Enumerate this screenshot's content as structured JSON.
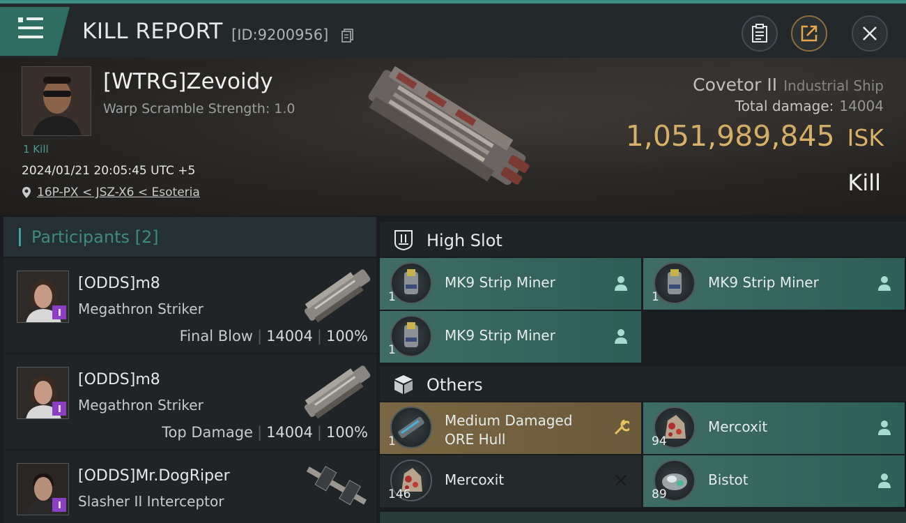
{
  "header": {
    "title": "KILL REPORT",
    "report_id": "[ID:9200956]"
  },
  "victim": {
    "name": "[WTRG]Zevoidy",
    "warp_scramble": "Warp Scramble Strength: 1.0",
    "kill_count": "1 Kill",
    "timestamp": "2024/01/21 20:05:45 UTC +5",
    "location": "16P-PX < JSZ-X6 < Esoteria",
    "ship_name": "Covetor II",
    "ship_class": "Industrial Ship",
    "total_damage_label": "Total damage:",
    "total_damage_value": "14004",
    "isk_value": "1,051,989,845",
    "isk_unit": "ISK",
    "result": "Kill"
  },
  "participants": {
    "header": "Participants [2]",
    "items": [
      {
        "name": "[ODDS]m8",
        "ship": "Megathron Striker",
        "role": "Final Blow",
        "damage": "14004",
        "percent": "100%"
      },
      {
        "name": "[ODDS]m8",
        "ship": "Megathron Striker",
        "role": "Top Damage",
        "damage": "14004",
        "percent": "100%"
      },
      {
        "name": "[ODDS]Mr.DogRiper",
        "ship": "Slasher II Interceptor"
      }
    ]
  },
  "high_slot": {
    "label": "High Slot",
    "items": [
      {
        "name": "MK9 Strip Miner",
        "qty": "1",
        "status_icon": "person-icon"
      },
      {
        "name": "MK9 Strip Miner",
        "qty": "1",
        "status_icon": "person-icon"
      },
      {
        "name": "MK9 Strip Miner",
        "qty": "1",
        "status_icon": "person-icon"
      }
    ]
  },
  "others": {
    "label": "Others",
    "items": [
      {
        "name_line1": "Medium Damaged",
        "name_line2": "ORE Hull",
        "qty": "1",
        "status_icon": "wrench-icon"
      },
      {
        "name": "Mercoxit",
        "qty": "94",
        "status_icon": "person-icon"
      },
      {
        "name": "Mercoxit",
        "qty": "146",
        "status_icon": "close-icon"
      },
      {
        "name": "Bistot",
        "qty": "89",
        "status_icon": "person-icon"
      }
    ]
  },
  "colors": {
    "accent_teal": "#3d8a7e",
    "isk_gold": "#e8be6a",
    "dropped_slot": "#2d5e57",
    "special_slot": "#6a5a3b"
  }
}
